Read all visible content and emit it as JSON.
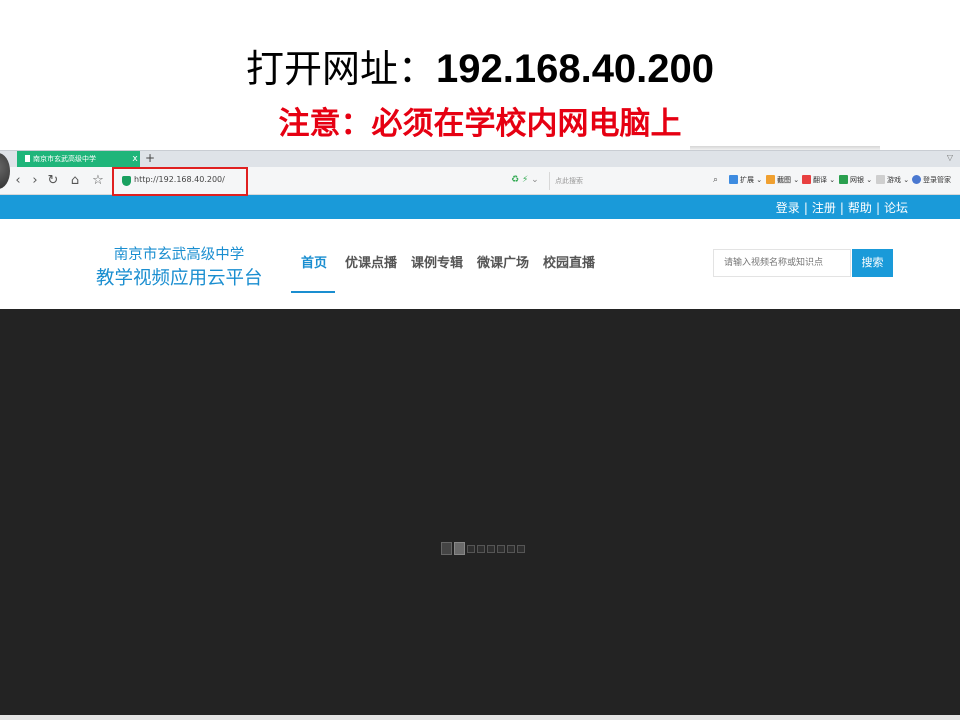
{
  "slide": {
    "title_prefix": "打开网址：",
    "title_address": "192.168.40.200",
    "subtitle": "注意：必须在学校内网电脑上"
  },
  "browser": {
    "tab_title": "南京市玄武高级中学",
    "tab_close": "x",
    "new_tab": "+",
    "url": "http://192.168.40.200/",
    "quick_search_placeholder": "点此搜索",
    "extensions": [
      "扩展",
      "截图",
      "翻译",
      "网银",
      "游戏",
      "登录管家"
    ]
  },
  "site": {
    "top_links": [
      "登录",
      "注册",
      "帮助",
      "论坛"
    ],
    "separator": "|",
    "logo_line1": "南京市玄武高级中学",
    "logo_line2": "教学视频应用云平台",
    "menu": [
      "首页",
      "优课点播",
      "课例专辑",
      "微课广场",
      "校园直播"
    ],
    "search_placeholder": "请输入视频名称或知识点",
    "search_button": "搜索"
  },
  "colors": {
    "subtitle_red": "#e60012",
    "brand_blue": "#1a9ad9",
    "tab_green": "#1fb57a",
    "highlight_box": "#e02020",
    "player_bg": "#232323"
  }
}
